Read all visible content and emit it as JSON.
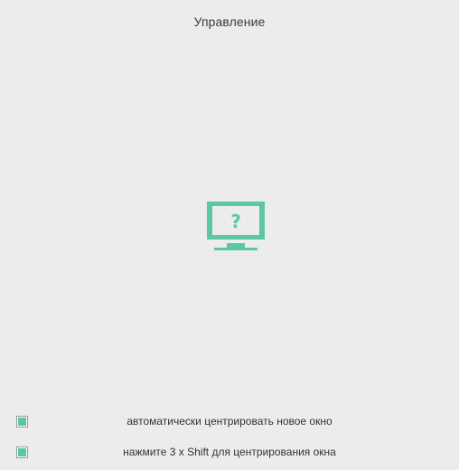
{
  "header": {
    "title": "Управление"
  },
  "hero": {
    "icon": "monitor-question-icon",
    "glyph": "?",
    "color": "#5bc8a0"
  },
  "options": [
    {
      "label": "автоматически центрировать новое окно",
      "checked": true
    },
    {
      "label": "нажмите 3 x Shift для центрирования окна",
      "checked": true
    }
  ],
  "colors": {
    "background": "#ececec",
    "accent": "#5bc8a0"
  }
}
